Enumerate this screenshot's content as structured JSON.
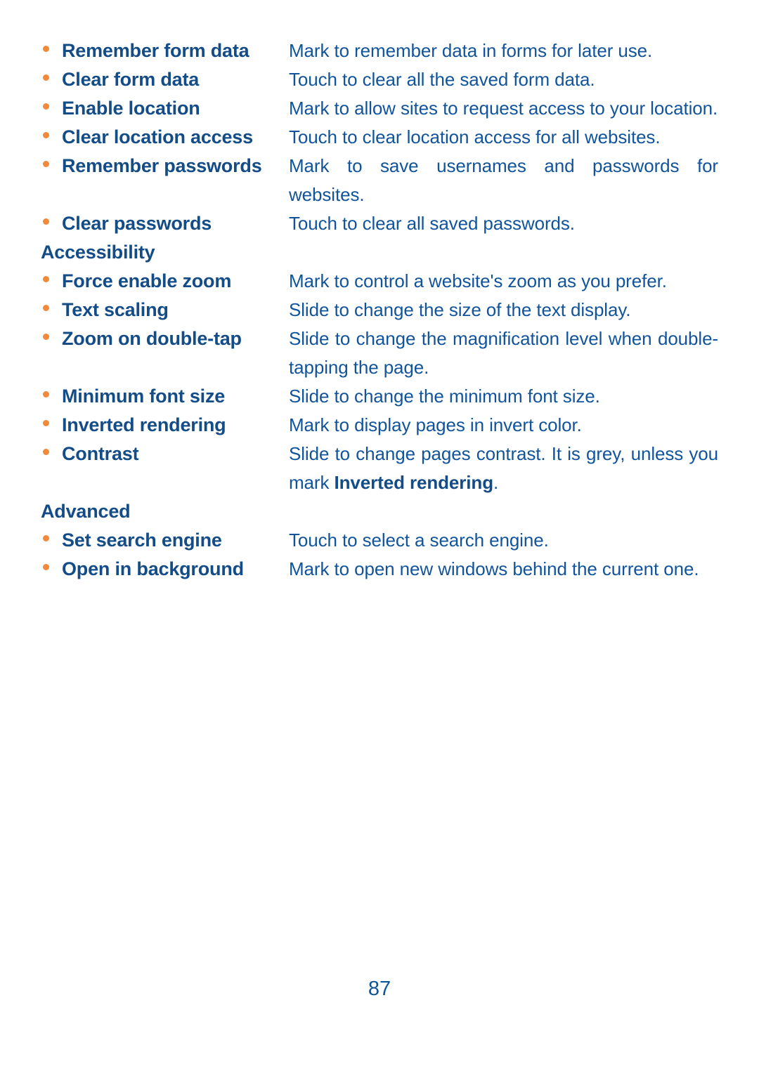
{
  "page": {
    "number": "87",
    "accent_bullet_color": "#F0893B",
    "term_color": "#134C86",
    "description_color": "#12549B"
  },
  "blocks": [
    {
      "kind": "entry",
      "term": "Remember form data",
      "description": "Mark to remember data in forms for later use."
    },
    {
      "kind": "entry",
      "term": "Clear form data",
      "description": "Touch to clear all the saved form data."
    },
    {
      "kind": "entry",
      "term": "Enable location",
      "description": "Mark to allow sites to request access to your location."
    },
    {
      "kind": "entry",
      "term": "Clear location access",
      "description": "Touch to clear location access for all websites."
    },
    {
      "kind": "entry",
      "term": "Remember passwords",
      "description": "Mark to save usernames and passwords for websites."
    },
    {
      "kind": "entry",
      "term": "Clear passwords",
      "description": "Touch to clear all saved passwords."
    },
    {
      "kind": "heading",
      "text": "Accessibility"
    },
    {
      "kind": "entry",
      "term": "Force enable zoom",
      "description": "Mark to control a website's zoom as you prefer."
    },
    {
      "kind": "entry",
      "term": "Text scaling",
      "description": "Slide to change the size of the text display."
    },
    {
      "kind": "entry",
      "term": "Zoom on double-tap",
      "description": "Slide to change the magnification level when double-tapping the page."
    },
    {
      "kind": "entry",
      "term": "Minimum font size",
      "description": "Slide to change the minimum font size."
    },
    {
      "kind": "entry",
      "term": "Inverted rendering",
      "description": "Mark to display pages in invert color."
    },
    {
      "kind": "entry",
      "term": "Contrast",
      "description_parts": [
        {
          "text": "Slide to change pages contrast. It is grey, unless you mark ",
          "bold": false
        },
        {
          "text": "Inverted rendering",
          "bold": true
        },
        {
          "text": ".",
          "bold": false
        }
      ],
      "description": "Slide to change pages contrast. It is grey, unless you mark Inverted rendering."
    },
    {
      "kind": "heading",
      "text": "Advanced"
    },
    {
      "kind": "entry",
      "term": "Set search engine",
      "description": "Touch to select a search engine."
    },
    {
      "kind": "entry",
      "term": "Open in background",
      "description": "Mark to open new windows behind the current one."
    }
  ]
}
